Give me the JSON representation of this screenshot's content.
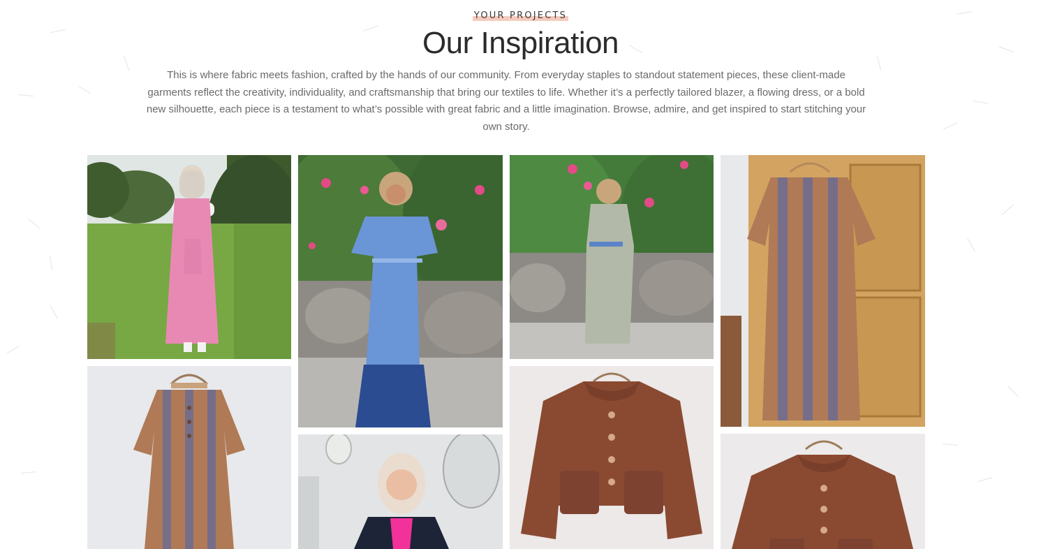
{
  "section": {
    "eyebrow": "YOUR PROJECTS",
    "title": "Our Inspiration",
    "intro": "This is where fabric meets fashion, crafted by the hands of our community. From everyday staples to standout statement pieces, these client-made garments reflect the creativity, individuality, and craftsmanship that bring our textiles to life. Whether it’s a perfectly tailored blazer, a flowing dress, or a bold new silhouette, each piece is a testament to what’s possible with great fabric and a little imagination. Browse, admire, and get inspired to start stitching your own story."
  },
  "colors": {
    "eyebrow_highlight": "#f4cbbd",
    "title_text": "#2b2b2b",
    "body_text": "#6a6a6a"
  },
  "gallery": [
    {
      "subject": "woman in pink linen pinafore dress on a lawn"
    },
    {
      "subject": "woman in blue ombre off-shoulder maxi dress"
    },
    {
      "subject": "woman in grey floral maxi dress with blue belt"
    },
    {
      "subject": "striped brown and blue dress on a hanger by wardrobe"
    },
    {
      "subject": "striped brown and blue dress on a hanger"
    },
    {
      "subject": "woman in navy jacket over pink top"
    },
    {
      "subject": "rust wool jacket with patch pockets on a hanger"
    },
    {
      "subject": "rust wool jacket on a hanger"
    }
  ]
}
